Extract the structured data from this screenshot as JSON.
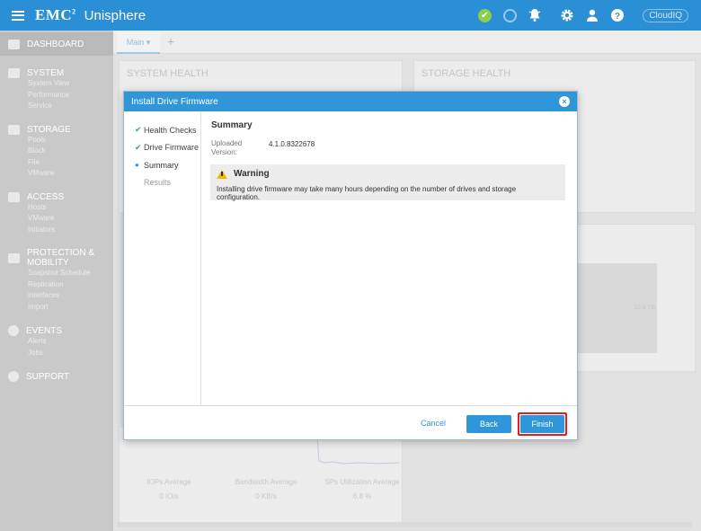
{
  "app": {
    "brand": "EMC",
    "brand_sup": "2",
    "product": "Unisphere",
    "cloudiq": "CloudIQ"
  },
  "sidebar": {
    "dashboard": "DASHBOARD",
    "system": {
      "label": "SYSTEM",
      "items": [
        "System View",
        "Performance",
        "Service"
      ]
    },
    "storage": {
      "label": "STORAGE",
      "items": [
        "Pools",
        "Block",
        "File",
        "VMware"
      ]
    },
    "access": {
      "label": "ACCESS",
      "items": [
        "Hosts",
        "VMware",
        "Initiators"
      ]
    },
    "protection": {
      "label": "PROTECTION &",
      "label2": "MOBILITY",
      "items": [
        "Snapshot Schedule",
        "Replication",
        "Interfaces",
        "Import"
      ]
    },
    "events": {
      "label": "EVENTS",
      "items": [
        "Alerts",
        "Jobs"
      ]
    },
    "support": {
      "label": "SUPPORT"
    }
  },
  "dashboard": {
    "tab": "Main",
    "system_health": "SYSTEM HEALTH",
    "storage_health": "STORAGE HEALTH",
    "tb_value": "10.8 TB",
    "stats": [
      {
        "label": "IOPs Average",
        "value": "0 IO/s"
      },
      {
        "label": "Bandwidth Average",
        "value": "0 KB/s"
      },
      {
        "label": "SPs Utilization Average",
        "value": "6.8 %"
      }
    ]
  },
  "modal": {
    "title": "Install Drive Firmware",
    "close": "×",
    "steps": [
      {
        "label": "Health Checks",
        "state": "done"
      },
      {
        "label": "Drive Firmware",
        "state": "done"
      },
      {
        "label": "Summary",
        "state": "current"
      },
      {
        "label": "Results",
        "state": "pending"
      }
    ],
    "summary_title": "Summary",
    "uploaded_label": "Uploaded Version:",
    "uploaded_value": "4.1.0.8322678",
    "warning_title": "Warning",
    "warning_text": "Installing drive firmware may take many hours depending on the number of drives and storage configuration.",
    "cancel": "Cancel",
    "back": "Back",
    "finish": "Finish"
  },
  "colors": {
    "accent": "#2f96da",
    "highlight": "#e41b23",
    "check": "#3aa86b",
    "warning": "#f1b800"
  }
}
